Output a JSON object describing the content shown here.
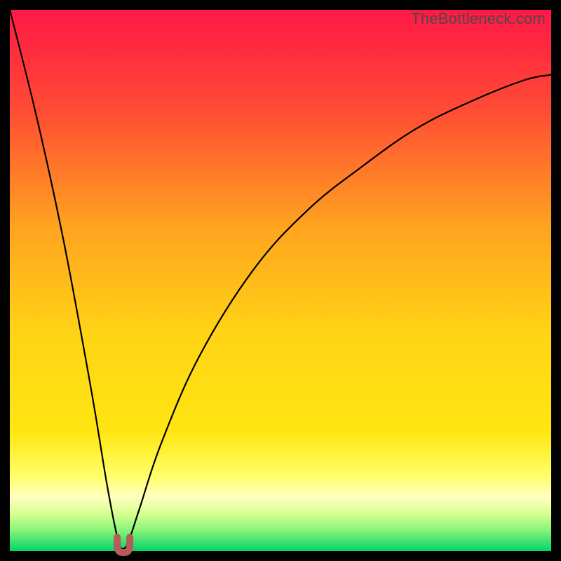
{
  "watermark": "TheBottleneck.com",
  "colors": {
    "top": "#ff1846",
    "mid1": "#ff6a2a",
    "mid2": "#ffc21a",
    "mid3": "#ffe612",
    "paleYellow": "#ffffa8",
    "nearBottom": "#c4ff7a",
    "bottom": "#00d46a",
    "curveStroke": "#000000",
    "markerStroke": "#b85a5a",
    "frame": "#000000"
  },
  "chart_data": {
    "type": "line",
    "title": "",
    "xlabel": "",
    "ylabel": "",
    "xlim": [
      0,
      100
    ],
    "ylim": [
      0,
      100
    ],
    "notes": "Bottleneck-style V-curve. Minimum (optimal point) near x≈21 where value≈0. Left branch rises steeply to ~100 at x=0; right branch rises with decreasing slope toward ~88 at x=100.",
    "series": [
      {
        "name": "bottleneck-curve",
        "x": [
          0,
          5,
          10,
          15,
          18,
          20,
          21,
          22,
          24,
          28,
          35,
          45,
          55,
          65,
          75,
          85,
          95,
          100
        ],
        "values": [
          100,
          80,
          57,
          30,
          12,
          2,
          0.5,
          2,
          8,
          20,
          36,
          52,
          63,
          71,
          78,
          83,
          87,
          88
        ]
      }
    ],
    "optimal_marker": {
      "x": 21,
      "value": 0.5
    }
  }
}
